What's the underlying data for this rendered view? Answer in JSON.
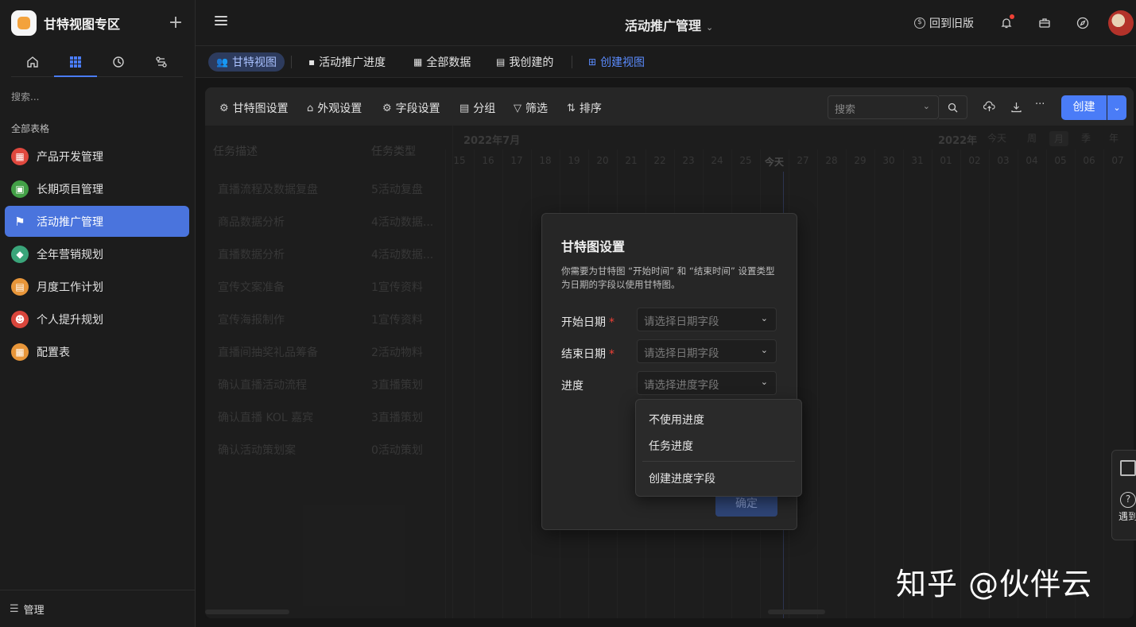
{
  "workspace": {
    "title": "甘特视图专区"
  },
  "sidebar": {
    "search_placeholder": "搜索...",
    "section_title": "全部表格",
    "items": [
      {
        "label": "产品开发管理",
        "color": "#e0483e",
        "icon": "grid-icon"
      },
      {
        "label": "长期项目管理",
        "color": "#43a047",
        "icon": "calendar-icon"
      },
      {
        "label": "活动推广管理",
        "color": "#ffffff",
        "icon": "flag-icon",
        "active": true
      },
      {
        "label": "全年营销规划",
        "color": "#3aa57a",
        "icon": "tag-icon"
      },
      {
        "label": "月度工作计划",
        "color": "#e8963a",
        "icon": "clipboard-icon"
      },
      {
        "label": "个人提升规划",
        "color": "#d9463c",
        "icon": "face-icon"
      },
      {
        "label": "配置表",
        "color": "#e8963a",
        "icon": "grid-icon"
      }
    ],
    "footer_label": "管理"
  },
  "topbar": {
    "title": "活动推广管理",
    "old_version": "回到旧版"
  },
  "views": {
    "tabs": [
      "甘特视图",
      "活动推广进度",
      "全部数据",
      "我创建的"
    ],
    "create": "创建视图"
  },
  "toolbar": {
    "gantt_settings": "甘特图设置",
    "appearance": "外观设置",
    "field_settings": "字段设置",
    "group": "分组",
    "filter": "筛选",
    "sort": "排序",
    "search_placeholder": "搜索",
    "more": "···",
    "create": "创建"
  },
  "grid": {
    "col_desc": "任务描述",
    "col_type": "任务类型",
    "rows": [
      {
        "desc": "直播流程及数据复盘",
        "type": "5活动复盘"
      },
      {
        "desc": "商品数据分析",
        "type": "4活动数据..."
      },
      {
        "desc": "直播数据分析",
        "type": "4活动数据..."
      },
      {
        "desc": "宣传文案准备",
        "type": "1宣传资料"
      },
      {
        "desc": "宣传海报制作",
        "type": "1宣传资料"
      },
      {
        "desc": "直播间抽奖礼品筹备",
        "type": "2活动物料"
      },
      {
        "desc": "确认直播活动流程",
        "type": "3直播策划"
      },
      {
        "desc": "确认直播 KOL 嘉宾",
        "type": "3直播策划"
      },
      {
        "desc": "确认活动策划案",
        "type": "0活动策划"
      }
    ]
  },
  "timeline": {
    "month1": "2022年7月",
    "month2": "2022年",
    "scales": [
      "今天",
      "周",
      "月",
      "季",
      "年"
    ],
    "days": [
      "15",
      "16",
      "17",
      "18",
      "19",
      "20",
      "21",
      "22",
      "23",
      "24",
      "25",
      "今天",
      "27",
      "28",
      "29",
      "30",
      "31",
      "01",
      "02",
      "03",
      "04",
      "05",
      "06",
      "07"
    ]
  },
  "dialog": {
    "title": "甘特图设置",
    "desc": "你需要为甘特图 “开始时间” 和 “结束时间” 设置类型为日期的字段以使用甘特图。",
    "start_label": "开始日期",
    "end_label": "结束日期",
    "progress_label": "进度",
    "date_placeholder": "请选择日期字段",
    "progress_placeholder": "请选择进度字段",
    "ok": "确定"
  },
  "dropdown": {
    "items": [
      "不使用进度",
      "任务进度",
      "创建进度字段"
    ]
  },
  "help_widget": {
    "text": "遇到问题"
  },
  "watermark": "知乎 @伙伴云"
}
